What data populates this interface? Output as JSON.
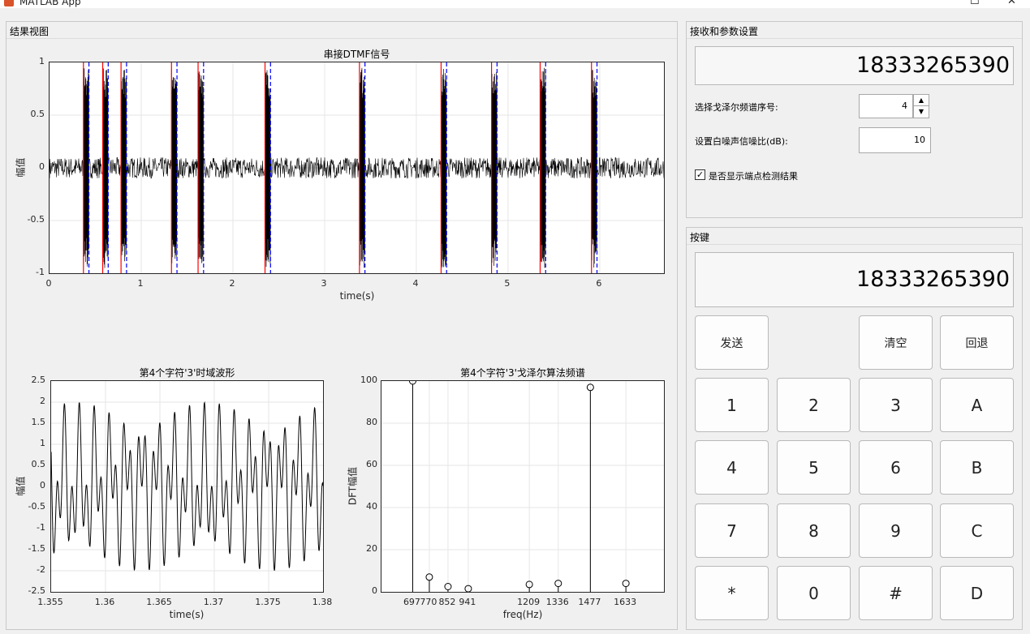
{
  "window": {
    "title": "MATLAB App",
    "maximize_glyph": "☐",
    "close_glyph": "✕"
  },
  "results_panel": {
    "title": "结果视图",
    "main_plot": {
      "title": "串接DTMF信号",
      "xlabel": "time(s)",
      "ylabel": "幅值",
      "yticks": [
        "1",
        "0.5",
        "0",
        "-0.5",
        "-1"
      ],
      "xticks": [
        "0",
        "1",
        "2",
        "3",
        "4",
        "5",
        "6"
      ]
    },
    "time_plot": {
      "title": "第4个字符'3'时域波形",
      "xlabel": "time(s)",
      "ylabel": "幅值",
      "yticks": [
        "2.5",
        "2",
        "1.5",
        "1",
        "0.5",
        "0",
        "-0.5",
        "-1",
        "-1.5",
        "-2",
        "-2.5"
      ],
      "xticks": [
        "1.355",
        "1.36",
        "1.365",
        "1.37",
        "1.375",
        "1.38"
      ]
    },
    "freq_plot": {
      "title": "第4个字符'3'戈泽尔算法频谱",
      "xlabel": "freq(Hz)",
      "ylabel": "DFT幅值",
      "yticks": [
        "100",
        "80",
        "60",
        "40",
        "20",
        "0"
      ],
      "xticks": [
        "697",
        "770",
        "852",
        "941",
        "1209",
        "1336",
        "1477",
        "1633"
      ]
    }
  },
  "chart_data": [
    {
      "type": "line",
      "title": "串接DTMF信号",
      "xlabel": "time(s)",
      "ylabel": "幅值",
      "xlim": [
        0,
        6.7
      ],
      "ylim": [
        -1,
        1
      ],
      "grid": true,
      "signal_segments": [
        [
          0.37,
          0.43
        ],
        [
          0.58,
          0.64
        ],
        [
          0.78,
          0.84
        ],
        [
          1.33,
          1.39
        ],
        [
          1.62,
          1.68
        ],
        [
          2.35,
          2.41
        ],
        [
          3.38,
          3.44
        ],
        [
          4.27,
          4.33
        ],
        [
          4.82,
          4.88
        ],
        [
          5.35,
          5.41
        ],
        [
          5.91,
          5.97
        ]
      ],
      "start_markers": [
        0.37,
        0.58,
        0.78,
        1.33,
        1.62,
        2.35,
        3.38,
        4.27,
        4.82,
        5.35,
        5.91
      ],
      "end_markers": [
        0.43,
        0.64,
        0.84,
        1.39,
        1.68,
        2.41,
        3.44,
        4.33,
        4.88,
        5.41,
        5.97
      ],
      "noise_amplitude": 0.1,
      "colors": {
        "signal": "#000000",
        "start": "#ff0000",
        "end": "#0000ff"
      }
    },
    {
      "type": "line",
      "title": "第4个字符'3'时域波形",
      "xlabel": "time(s)",
      "ylabel": "幅值",
      "xlim": [
        1.355,
        1.38
      ],
      "ylim": [
        -2.5,
        2.5
      ],
      "grid": true,
      "tones_hz": [
        697,
        1477
      ],
      "colors": {
        "line": "#000000"
      }
    },
    {
      "type": "stem",
      "title": "第4个字符'3'戈泽尔算法频谱",
      "xlabel": "freq(Hz)",
      "ylabel": "DFT幅值",
      "xlim": [
        560,
        1800
      ],
      "ylim": [
        0,
        100
      ],
      "grid": true,
      "x": [
        697,
        770,
        852,
        941,
        1209,
        1336,
        1477,
        1633
      ],
      "values": [
        100,
        7,
        2.5,
        1.5,
        3.5,
        4,
        97,
        4
      ],
      "colors": {
        "stem": "#000000"
      }
    }
  ],
  "receive_panel": {
    "title": "接收和参数设置",
    "display_value": "18333265390",
    "spectrum_index_label": "选择戈泽尔频谱序号:",
    "spectrum_index_value": "4",
    "snr_label": "设置白噪声信噪比(dB):",
    "snr_value": "10",
    "show_endpoint_label": "是否显示端点检测结果",
    "show_endpoint_checked": "✓"
  },
  "keypad_panel": {
    "title": "按键",
    "display_value": "18333265390",
    "send_label": "发送",
    "clear_label": "清空",
    "back_label": "回退",
    "keys": [
      "1",
      "2",
      "3",
      "A",
      "4",
      "5",
      "6",
      "B",
      "7",
      "8",
      "9",
      "C",
      "*",
      "0",
      "#",
      "D"
    ]
  }
}
